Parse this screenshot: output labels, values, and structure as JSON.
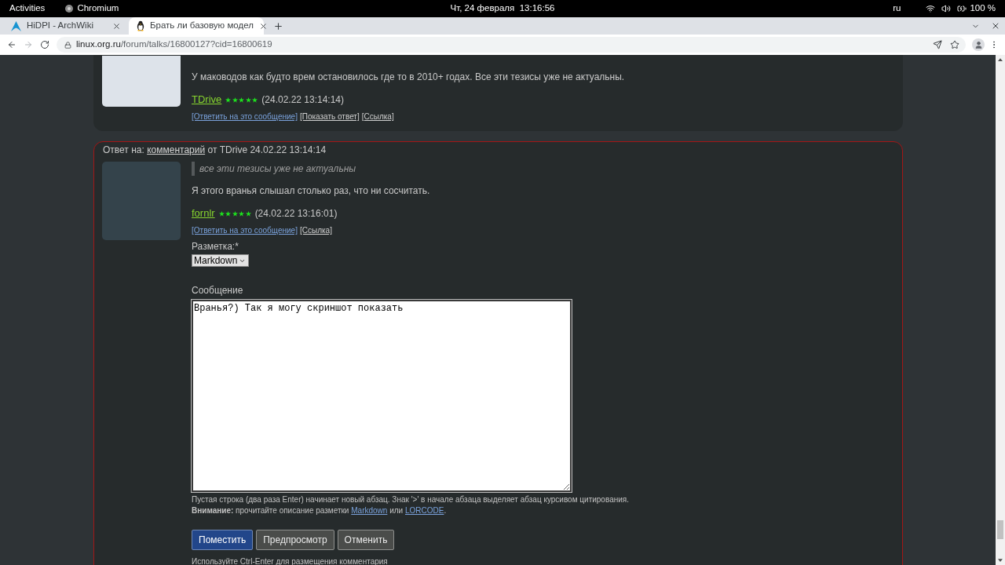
{
  "system_bar": {
    "activities": "Activities",
    "app_name": "Chromium",
    "clock": "Чт, 24 февраля  13:16:56",
    "keyboard_layout": "ru",
    "battery": "100 %"
  },
  "tabs": [
    {
      "title": "HiDPI - ArchWiki",
      "selected": false
    },
    {
      "title": "Брать ли базовую модел",
      "selected": true
    }
  ],
  "address_bar": {
    "domain": "linux.org.ru",
    "path": "/forum/talks/16800127?cid=16800619"
  },
  "posts": [
    {
      "highlighted": false,
      "body": "У маководов как будто врем остановилось где то в 2010+ годах. Все эти тезисы уже не актуальны.",
      "author": "TDrive",
      "stars": 5,
      "date": "(24.02.22 13:14:14)",
      "links": [
        {
          "label": "[Ответить на это сообщение]",
          "visited": false
        },
        {
          "label": "[Показать ответ]",
          "visited": true
        },
        {
          "label": "[Ссылка]",
          "visited": true
        }
      ]
    },
    {
      "highlighted": true,
      "reply_to": {
        "prefix": "Ответ на:",
        "link": "комментарий",
        "suffix": "от TDrive 24.02.22 13:14:14"
      },
      "quote": "все эти тезисы уже не актуальны",
      "body": "Я этого вранья слышал столько раз, что ни сосчитать.",
      "author": "fornlr",
      "stars": 5,
      "date": "(24.02.22 13:16:01)",
      "links": [
        {
          "label": "[Ответить на это сообщение]",
          "visited": false
        },
        {
          "label": "[Ссылка]",
          "visited": true
        }
      ],
      "reply_form": {
        "markup": {
          "label": "Разметка:*",
          "value": "Markdown"
        },
        "message": {
          "label": "Сообщение",
          "value": "Вранья?) Так я могу скриншот показать"
        },
        "hint": "Пустая строка (два раза Enter) начинает новый абзац. Знак '>' в начале абзаца выделяет абзац курсивом цитирования.",
        "notice": {
          "text": "**Внимание:** прочитайте описание разметки",
          "link_1": "Markdown",
          "joiner": "или",
          "link_2": "LORCODE",
          "end": "."
        },
        "buttons": [
          {
            "label": "Поместить",
            "kind": "primary"
          },
          {
            "label": "Предпросмотр",
            "kind": "secondary"
          },
          {
            "label": "Отменить",
            "kind": "secondary"
          }
        ],
        "footer": "Используйте Ctrl-Enter для размещения комментария"
      }
    }
  ]
}
